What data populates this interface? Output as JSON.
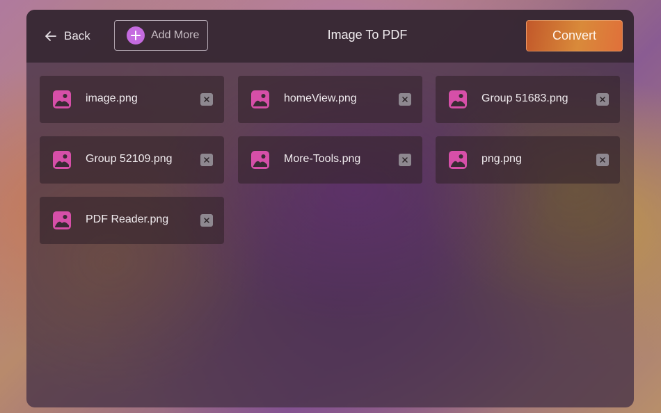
{
  "header": {
    "back_label": "Back",
    "add_more_label": "Add More",
    "title": "Image To PDF",
    "convert_label": "Convert"
  },
  "colors": {
    "accent": "#c56be0",
    "icon": "#d64fa8",
    "convert_gradient_start": "#c2582a",
    "convert_gradient_end": "#e0703a"
  },
  "icons": {
    "back": "arrow-left-icon",
    "add": "plus-circle-icon",
    "file": "image-file-icon",
    "remove": "close-icon"
  },
  "files": [
    {
      "name": "image.png"
    },
    {
      "name": "homeView.png"
    },
    {
      "name": "Group 51683.png"
    },
    {
      "name": "Group 52109.png"
    },
    {
      "name": "More-Tools.png"
    },
    {
      "name": "png.png"
    },
    {
      "name": "PDF Reader.png"
    }
  ]
}
